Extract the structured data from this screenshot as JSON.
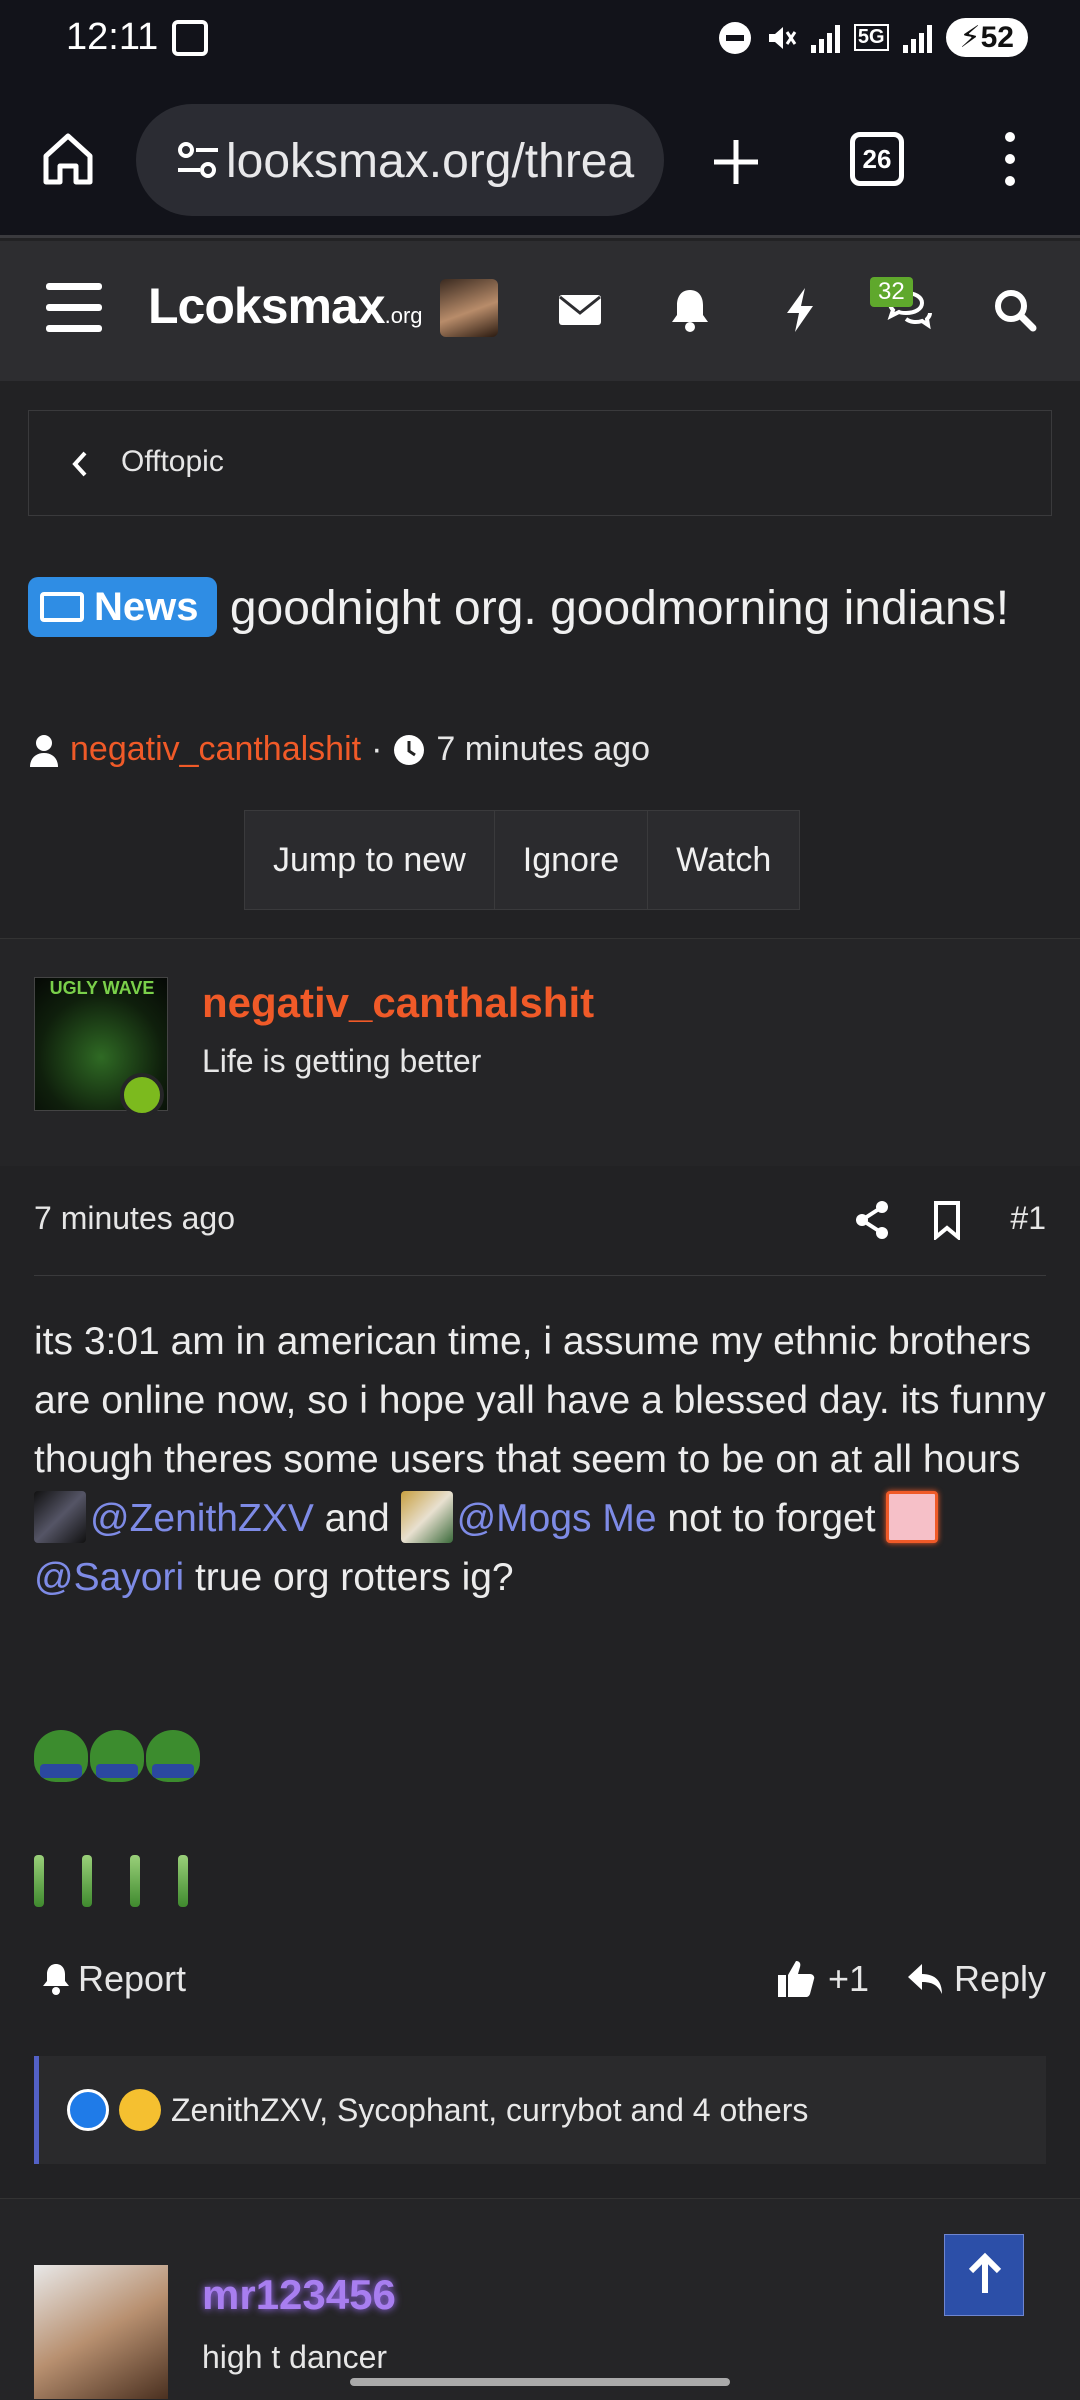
{
  "status_bar": {
    "time": "12:11",
    "battery": "52",
    "network": "5G"
  },
  "browser": {
    "url": "looksmax.org/threa",
    "tab_count": "26"
  },
  "site_nav": {
    "logo": "Lcoksmax",
    "logo_suffix": ".org",
    "notifications_badge": "32"
  },
  "breadcrumb": {
    "label": "Offtopic"
  },
  "thread": {
    "prefix": "News",
    "title": "goodnight org. goodmorning indians!",
    "author": "negativ_canthalshit",
    "separator": "·",
    "time": "7 minutes ago",
    "actions": [
      "Jump to new",
      "Ignore",
      "Watch"
    ]
  },
  "post": {
    "username": "negativ_canthalshit",
    "user_title": "Life is getting better",
    "avatar_text": "UGLY WAVE",
    "time": "7 minutes ago",
    "number": "#1",
    "text_1": "its 3:01 am in american time, i assume my ethnic brothers are online now, so i hope yall have a blessed day. its funny though theres some users that seem to be on at all hours ",
    "mention_1": "@ZenithZXV",
    "text_and": " and ",
    "mention_2": "@Mogs Me",
    "text_2": " not to forget ",
    "mention_3": "@Sayori",
    "text_3": " true org rotters ig?",
    "report_label": "Report",
    "like_label": "+1",
    "reply_label": "Reply",
    "reactions_text": "ZenithZXV, Sycophant, currybot and 4 others"
  },
  "next_post": {
    "username": "mr123456",
    "user_title": "high t dancer"
  },
  "colors": {
    "accent": "#f05a28",
    "mention": "#7e8be6",
    "news_badge": "#2f8de4",
    "online": "#7cba1e"
  }
}
